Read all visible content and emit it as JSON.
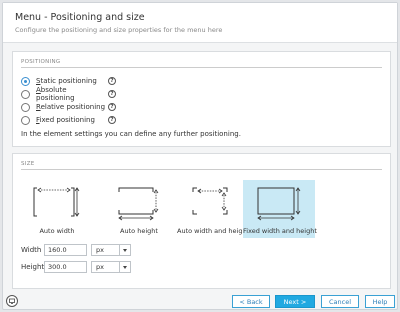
{
  "header": {
    "title": "Menu - Positioning and size",
    "subtitle": "Configure the positioning and size properties for the menu here"
  },
  "positioning": {
    "section_title": "POSITIONING",
    "options": [
      {
        "label": "Static positioning",
        "accel": "S",
        "checked": true
      },
      {
        "label": "Absolute positioning",
        "accel": "A",
        "checked": false
      },
      {
        "label": "Relative positioning",
        "accel": "R",
        "checked": false
      },
      {
        "label": "Fixed positioning",
        "accel": "F",
        "checked": false
      }
    ],
    "help_glyph": "?",
    "note": "In the element settings you can define any further positioning."
  },
  "size": {
    "section_title": "SIZE",
    "options": [
      {
        "label": "Auto width",
        "selected": false
      },
      {
        "label": "Auto height",
        "selected": false
      },
      {
        "label": "Auto width and height",
        "selected": false
      },
      {
        "label": "Fixed width and height",
        "selected": true
      }
    ],
    "selected_color": "#c9e9f5",
    "width": {
      "label": "Width",
      "value": "160.0",
      "unit": "px"
    },
    "height": {
      "label": "Height",
      "value": "300.0",
      "unit": "px"
    }
  },
  "footer": {
    "back_label": "< Back",
    "next_label": "Next >",
    "cancel_label": "Cancel",
    "help_label": "Help",
    "left_icon": "info-icon"
  },
  "colors": {
    "accent": "#21a9e1",
    "accent_border": "#3aa1d4"
  }
}
